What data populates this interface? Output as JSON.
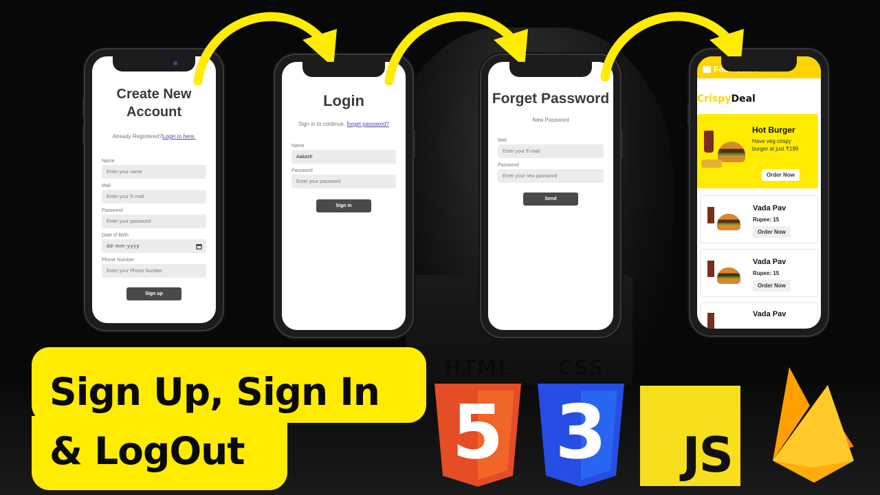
{
  "signup": {
    "title": "Create New Account",
    "already_text": "Already Registered?",
    "login_link": "Login in here.",
    "fields": [
      {
        "label": "Name",
        "placeholder": "Enter your name"
      },
      {
        "label": "Mail",
        "placeholder": "Enter your E-mail"
      },
      {
        "label": "Password",
        "placeholder": "Enter your password"
      },
      {
        "label": "Date of Birth",
        "placeholder": "dd-mm-yyyy"
      },
      {
        "label": "Phone Number",
        "placeholder": "Enter your Phone Number"
      }
    ],
    "button": "Sign up"
  },
  "login": {
    "title": "Login",
    "subtitle": "Sign in to continue.",
    "forget_link": "forget password?",
    "fields": [
      {
        "label": "Name",
        "value": "Aakash"
      },
      {
        "label": "Password",
        "placeholder": "Enter your password"
      }
    ],
    "button": "Sign in"
  },
  "forget": {
    "title": "Forget Password",
    "subtitle": "New Password",
    "fields": [
      {
        "label": "Mail",
        "placeholder": "Enter your E-mail"
      },
      {
        "label": "Password",
        "placeholder": "Enter your new password"
      }
    ],
    "button": "Send"
  },
  "food": {
    "brand": "Food Store",
    "section_title_1": "Crispy",
    "section_title_2": "Deal",
    "featured": {
      "name": "Hot Burger",
      "desc": "Have veg crispy burger at just ₹199",
      "button": "Order Now"
    },
    "items": [
      {
        "name": "Vada Pav",
        "price": "Rupee: 15",
        "button": "Order Now"
      },
      {
        "name": "Vada Pav",
        "price": "Rupee: 15",
        "button": "Order Now"
      },
      {
        "name": "Vada Pav"
      }
    ]
  },
  "headline": {
    "line1": "Sign Up, Sign In",
    "line2": "& LogOut"
  },
  "tech": {
    "html_label": "HTML",
    "html_digit": "5",
    "css_label": "CSS",
    "css_digit": "3",
    "js_label": "JS"
  },
  "colors": {
    "accent_yellow": "#ffec00",
    "html_orange": "#e44d26",
    "css_blue": "#264de4",
    "js_yellow": "#f7df1e",
    "firebase_orange": "#f58220"
  }
}
